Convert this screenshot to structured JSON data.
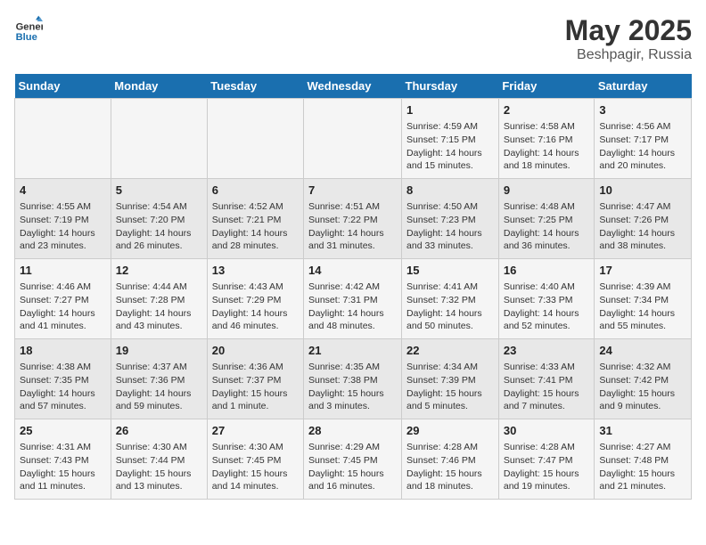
{
  "header": {
    "logo_general": "General",
    "logo_blue": "Blue",
    "title": "May 2025",
    "location": "Beshpagir, Russia"
  },
  "weekdays": [
    "Sunday",
    "Monday",
    "Tuesday",
    "Wednesday",
    "Thursday",
    "Friday",
    "Saturday"
  ],
  "weeks": [
    [
      {
        "day": "",
        "info": ""
      },
      {
        "day": "",
        "info": ""
      },
      {
        "day": "",
        "info": ""
      },
      {
        "day": "",
        "info": ""
      },
      {
        "day": "1",
        "info": "Sunrise: 4:59 AM\nSunset: 7:15 PM\nDaylight: 14 hours\nand 15 minutes."
      },
      {
        "day": "2",
        "info": "Sunrise: 4:58 AM\nSunset: 7:16 PM\nDaylight: 14 hours\nand 18 minutes."
      },
      {
        "day": "3",
        "info": "Sunrise: 4:56 AM\nSunset: 7:17 PM\nDaylight: 14 hours\nand 20 minutes."
      }
    ],
    [
      {
        "day": "4",
        "info": "Sunrise: 4:55 AM\nSunset: 7:19 PM\nDaylight: 14 hours\nand 23 minutes."
      },
      {
        "day": "5",
        "info": "Sunrise: 4:54 AM\nSunset: 7:20 PM\nDaylight: 14 hours\nand 26 minutes."
      },
      {
        "day": "6",
        "info": "Sunrise: 4:52 AM\nSunset: 7:21 PM\nDaylight: 14 hours\nand 28 minutes."
      },
      {
        "day": "7",
        "info": "Sunrise: 4:51 AM\nSunset: 7:22 PM\nDaylight: 14 hours\nand 31 minutes."
      },
      {
        "day": "8",
        "info": "Sunrise: 4:50 AM\nSunset: 7:23 PM\nDaylight: 14 hours\nand 33 minutes."
      },
      {
        "day": "9",
        "info": "Sunrise: 4:48 AM\nSunset: 7:25 PM\nDaylight: 14 hours\nand 36 minutes."
      },
      {
        "day": "10",
        "info": "Sunrise: 4:47 AM\nSunset: 7:26 PM\nDaylight: 14 hours\nand 38 minutes."
      }
    ],
    [
      {
        "day": "11",
        "info": "Sunrise: 4:46 AM\nSunset: 7:27 PM\nDaylight: 14 hours\nand 41 minutes."
      },
      {
        "day": "12",
        "info": "Sunrise: 4:44 AM\nSunset: 7:28 PM\nDaylight: 14 hours\nand 43 minutes."
      },
      {
        "day": "13",
        "info": "Sunrise: 4:43 AM\nSunset: 7:29 PM\nDaylight: 14 hours\nand 46 minutes."
      },
      {
        "day": "14",
        "info": "Sunrise: 4:42 AM\nSunset: 7:31 PM\nDaylight: 14 hours\nand 48 minutes."
      },
      {
        "day": "15",
        "info": "Sunrise: 4:41 AM\nSunset: 7:32 PM\nDaylight: 14 hours\nand 50 minutes."
      },
      {
        "day": "16",
        "info": "Sunrise: 4:40 AM\nSunset: 7:33 PM\nDaylight: 14 hours\nand 52 minutes."
      },
      {
        "day": "17",
        "info": "Sunrise: 4:39 AM\nSunset: 7:34 PM\nDaylight: 14 hours\nand 55 minutes."
      }
    ],
    [
      {
        "day": "18",
        "info": "Sunrise: 4:38 AM\nSunset: 7:35 PM\nDaylight: 14 hours\nand 57 minutes."
      },
      {
        "day": "19",
        "info": "Sunrise: 4:37 AM\nSunset: 7:36 PM\nDaylight: 14 hours\nand 59 minutes."
      },
      {
        "day": "20",
        "info": "Sunrise: 4:36 AM\nSunset: 7:37 PM\nDaylight: 15 hours\nand 1 minute."
      },
      {
        "day": "21",
        "info": "Sunrise: 4:35 AM\nSunset: 7:38 PM\nDaylight: 15 hours\nand 3 minutes."
      },
      {
        "day": "22",
        "info": "Sunrise: 4:34 AM\nSunset: 7:39 PM\nDaylight: 15 hours\nand 5 minutes."
      },
      {
        "day": "23",
        "info": "Sunrise: 4:33 AM\nSunset: 7:41 PM\nDaylight: 15 hours\nand 7 minutes."
      },
      {
        "day": "24",
        "info": "Sunrise: 4:32 AM\nSunset: 7:42 PM\nDaylight: 15 hours\nand 9 minutes."
      }
    ],
    [
      {
        "day": "25",
        "info": "Sunrise: 4:31 AM\nSunset: 7:43 PM\nDaylight: 15 hours\nand 11 minutes."
      },
      {
        "day": "26",
        "info": "Sunrise: 4:30 AM\nSunset: 7:44 PM\nDaylight: 15 hours\nand 13 minutes."
      },
      {
        "day": "27",
        "info": "Sunrise: 4:30 AM\nSunset: 7:45 PM\nDaylight: 15 hours\nand 14 minutes."
      },
      {
        "day": "28",
        "info": "Sunrise: 4:29 AM\nSunset: 7:45 PM\nDaylight: 15 hours\nand 16 minutes."
      },
      {
        "day": "29",
        "info": "Sunrise: 4:28 AM\nSunset: 7:46 PM\nDaylight: 15 hours\nand 18 minutes."
      },
      {
        "day": "30",
        "info": "Sunrise: 4:28 AM\nSunset: 7:47 PM\nDaylight: 15 hours\nand 19 minutes."
      },
      {
        "day": "31",
        "info": "Sunrise: 4:27 AM\nSunset: 7:48 PM\nDaylight: 15 hours\nand 21 minutes."
      }
    ]
  ]
}
